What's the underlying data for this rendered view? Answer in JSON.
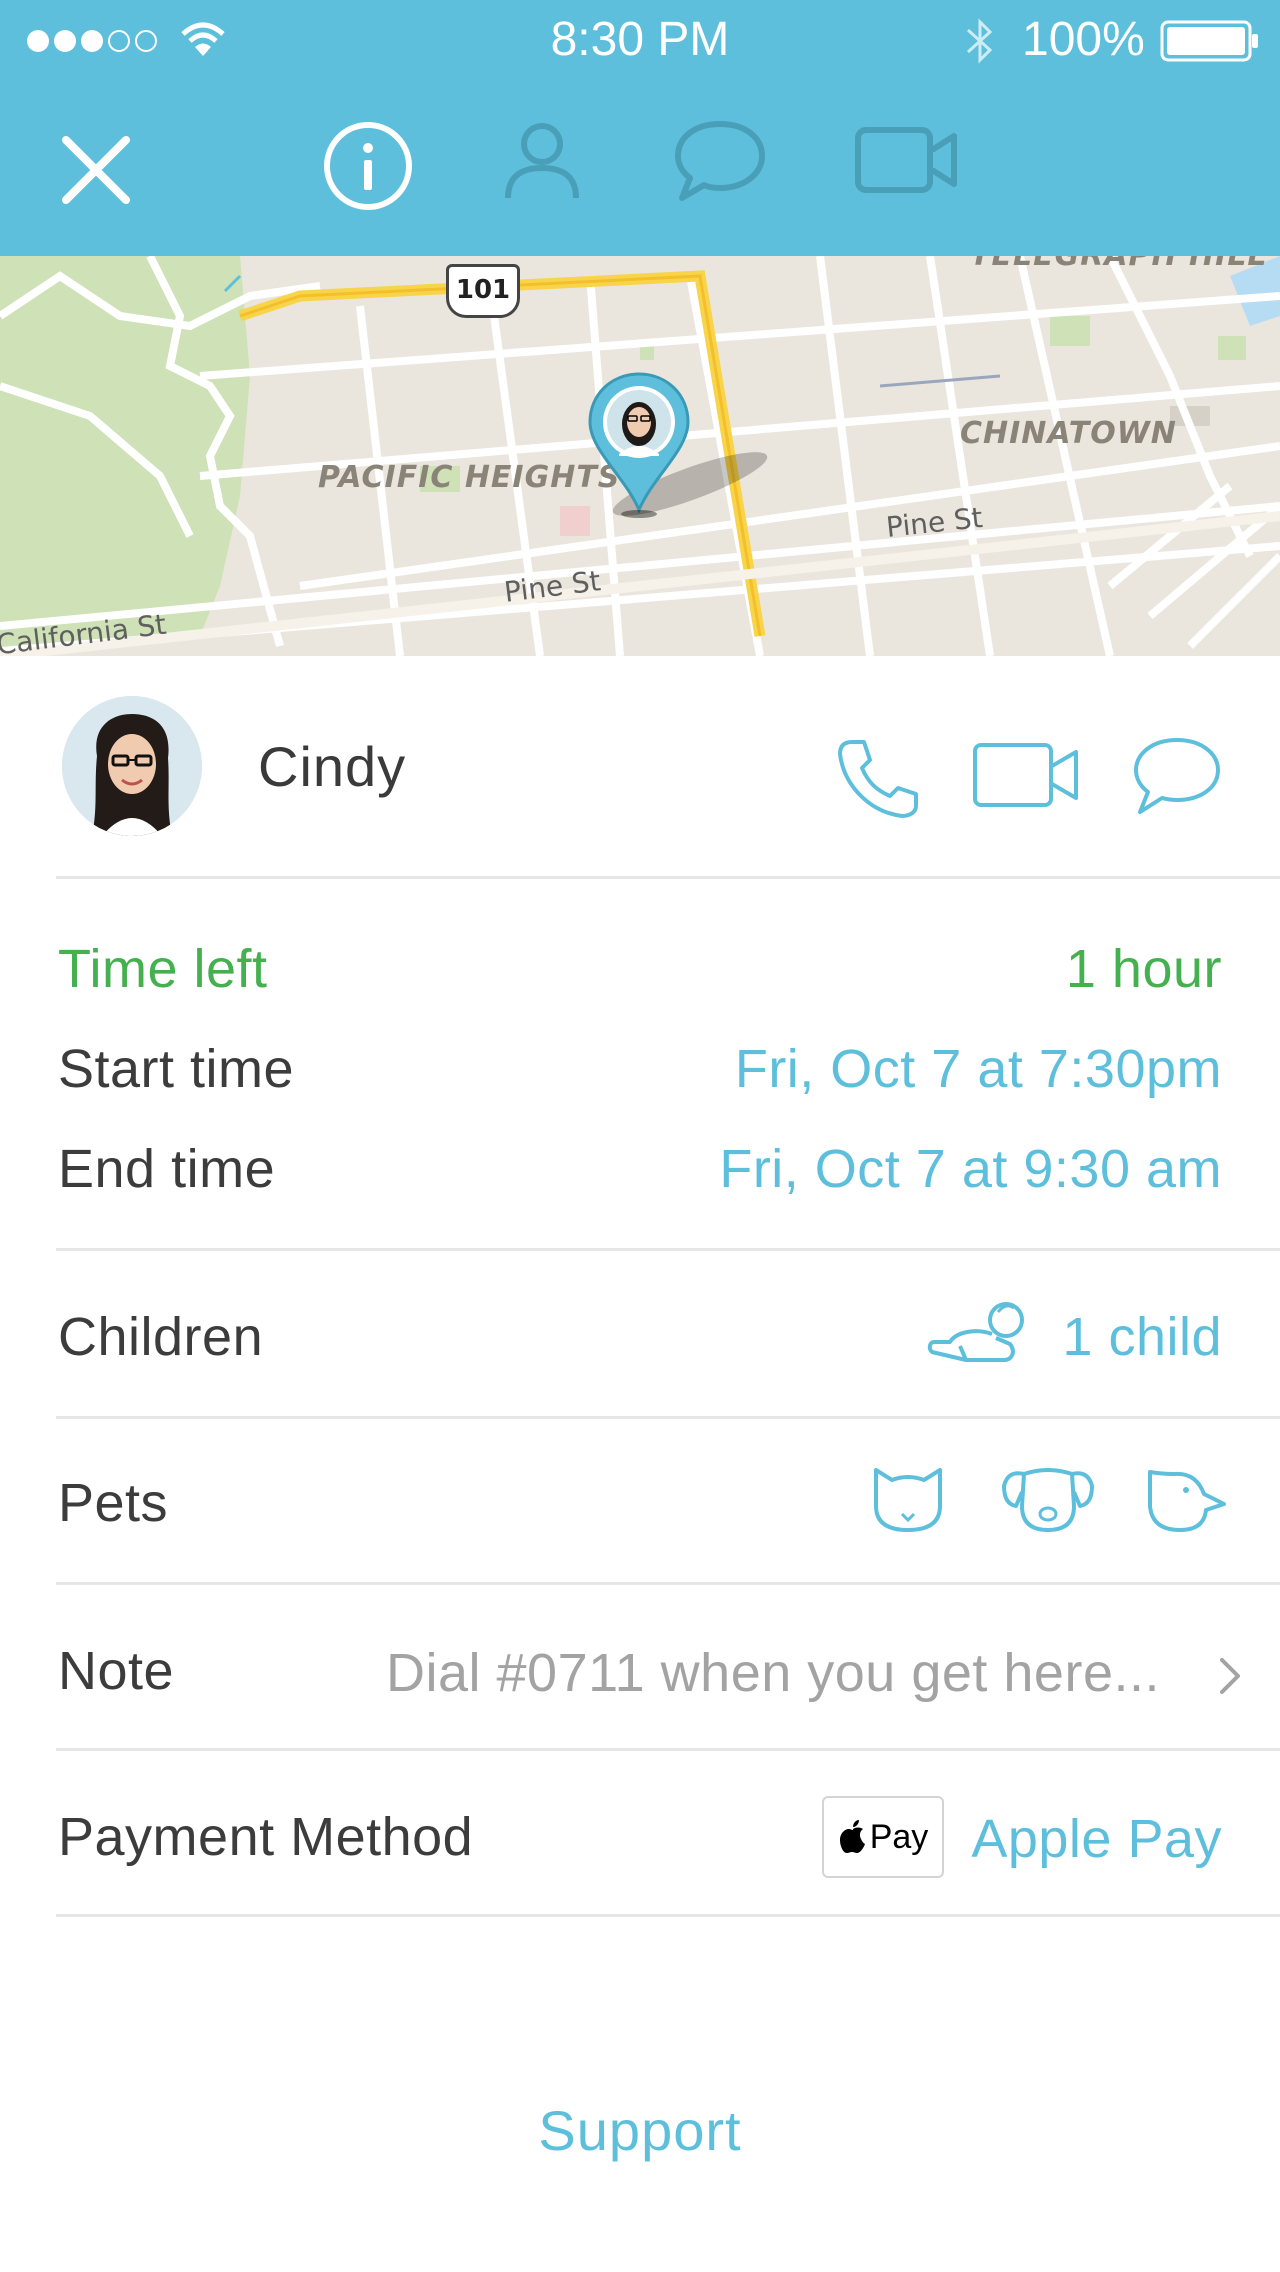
{
  "status_bar": {
    "time": "8:30 PM",
    "battery_percent": "100%"
  },
  "nav": {
    "icons": [
      "close-icon",
      "info-icon",
      "person-icon",
      "chat-icon",
      "video-icon"
    ],
    "active": "info-icon"
  },
  "map": {
    "labels": {
      "district_1": "PACIFIC HEIGHTS",
      "district_2": "CHINATOWN",
      "district_3": "TELEGRAPH HILL",
      "street_1": "Pine St",
      "street_2": "Pine St",
      "street_3": "California St",
      "highway": "101"
    }
  },
  "contact": {
    "name": "Cindy"
  },
  "details": {
    "time_left": {
      "label": "Time left",
      "value": "1 hour"
    },
    "start_time": {
      "label": "Start time",
      "value": "Fri, Oct 7 at 7:30pm"
    },
    "end_time": {
      "label": "End time",
      "value": "Fri, Oct 7 at 9:30 am"
    },
    "children": {
      "label": "Children",
      "value": "1 child"
    },
    "pets": {
      "label": "Pets",
      "icons": [
        "cat-icon",
        "dog-icon",
        "bird-icon"
      ]
    },
    "note": {
      "label": "Note",
      "value": "Dial #0711 when you get here..."
    },
    "payment": {
      "label": "Payment Method",
      "badge": "Pay",
      "value": "Apple Pay"
    }
  },
  "footer": {
    "support_label": "Support"
  },
  "colors": {
    "accent": "#5dbfdb",
    "green": "#45b04f",
    "text": "#3c3c3c",
    "muted": "#a3a3a3"
  }
}
